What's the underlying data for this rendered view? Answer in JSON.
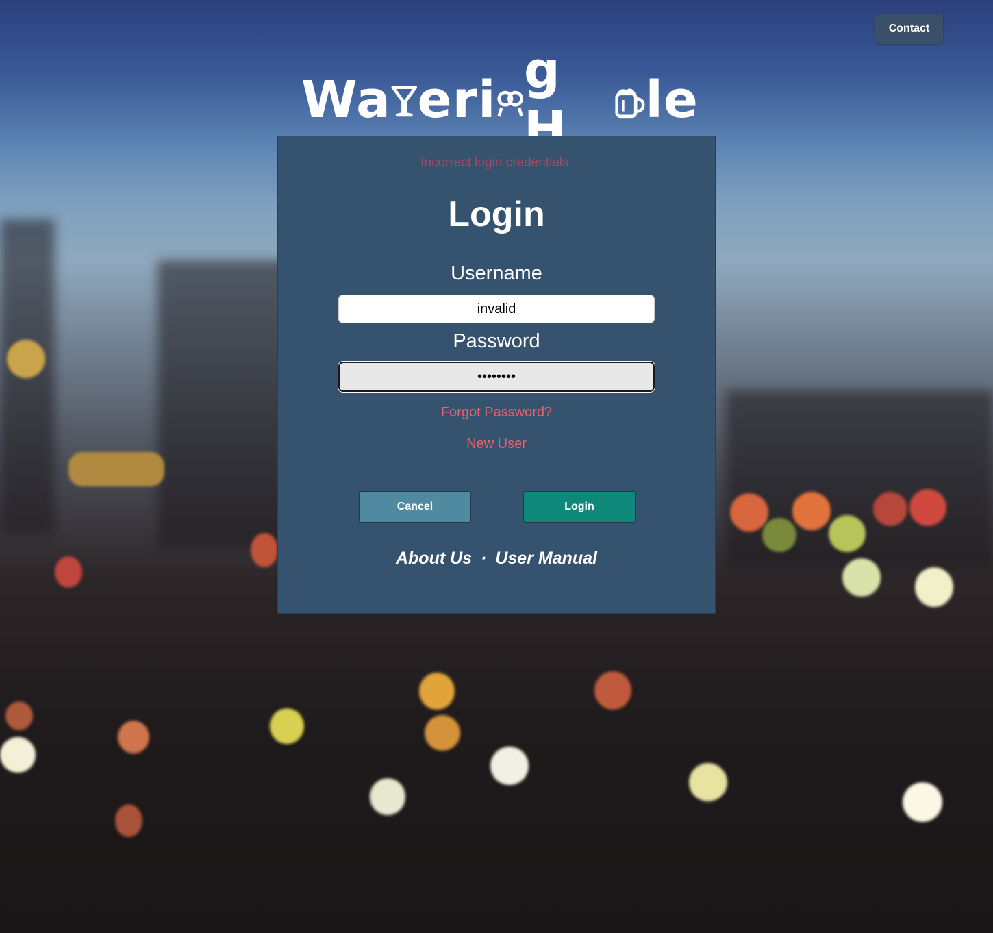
{
  "header": {
    "contact_label": "Contact"
  },
  "logo": {
    "text_part1": "Wa",
    "text_part2": "eri",
    "text_part3": "g H",
    "text_part4": "le"
  },
  "login_panel": {
    "error_message": "Incorrect login credentials.",
    "title": "Login",
    "username_label": "Username",
    "username_value": "invalid",
    "password_label": "Password",
    "password_value": "••••••••",
    "forgot_password": "Forgot Password?",
    "new_user": "New User",
    "cancel_label": "Cancel",
    "login_label": "Login",
    "about_us": "About Us",
    "separator": "·",
    "user_manual": "User Manual"
  },
  "colors": {
    "panel": "#35526f",
    "error": "#a94a63",
    "link": "#f0606a",
    "cancel": "#4f8aa0",
    "login": "#0e8878"
  }
}
